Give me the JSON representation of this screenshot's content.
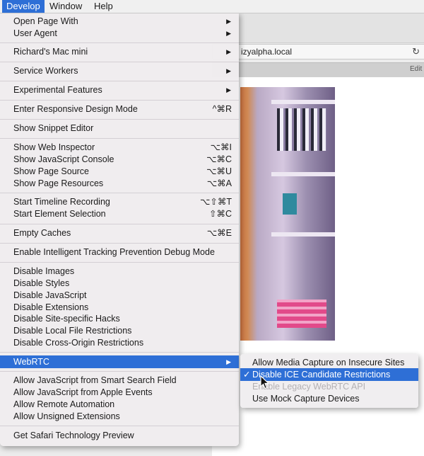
{
  "menubar": {
    "items": [
      {
        "label": "Develop"
      },
      {
        "label": "Window"
      },
      {
        "label": "Help"
      }
    ]
  },
  "browser": {
    "url": "izyalpha.local",
    "tab_label": "Edit"
  },
  "develop_menu": {
    "open_page_with": "Open Page With",
    "user_agent": "User Agent",
    "richards_mac_mini": "Richard's Mac mini",
    "service_workers": "Service Workers",
    "experimental_features": "Experimental Features",
    "responsive_design_mode": "Enter Responsive Design Mode",
    "responsive_design_mode_shortcut": "^⌘R",
    "show_snippet_editor": "Show Snippet Editor",
    "show_web_inspector": "Show Web Inspector",
    "show_web_inspector_shortcut": "⌥⌘I",
    "show_javascript_console": "Show JavaScript Console",
    "show_javascript_console_shortcut": "⌥⌘C",
    "show_page_source": "Show Page Source",
    "show_page_source_shortcut": "⌥⌘U",
    "show_page_resources": "Show Page Resources",
    "show_page_resources_shortcut": "⌥⌘A",
    "start_timeline_recording": "Start Timeline Recording",
    "start_timeline_recording_shortcut": "⌥⇧⌘T",
    "start_element_selection": "Start Element Selection",
    "start_element_selection_shortcut": "⇧⌘C",
    "empty_caches": "Empty Caches",
    "empty_caches_shortcut": "⌥⌘E",
    "itp_debug_mode": "Enable Intelligent Tracking Prevention Debug Mode",
    "disable_images": "Disable Images",
    "disable_styles": "Disable Styles",
    "disable_javascript": "Disable JavaScript",
    "disable_extensions": "Disable Extensions",
    "disable_site_specific_hacks": "Disable Site-specific Hacks",
    "disable_local_file_restrictions": "Disable Local File Restrictions",
    "disable_cross_origin_restrictions": "Disable Cross-Origin Restrictions",
    "webrtc": "WebRTC",
    "allow_js_smart_search": "Allow JavaScript from Smart Search Field",
    "allow_js_apple_events": "Allow JavaScript from Apple Events",
    "allow_remote_automation": "Allow Remote Automation",
    "allow_unsigned_extensions": "Allow Unsigned Extensions",
    "get_safari_tech_preview": "Get Safari Technology Preview"
  },
  "webrtc_submenu": {
    "allow_media_capture": "Allow Media Capture on Insecure Sites",
    "disable_ice_restrictions": "Disable ICE Candidate Restrictions",
    "disable_ice_checkmark": "✓",
    "enable_legacy_webrtc": "Enable Legacy WebRTC API",
    "use_mock_capture": "Use Mock Capture Devices"
  },
  "colors": {
    "highlight": "#2e6fd6",
    "disabled_text": "#b3b0b3"
  }
}
